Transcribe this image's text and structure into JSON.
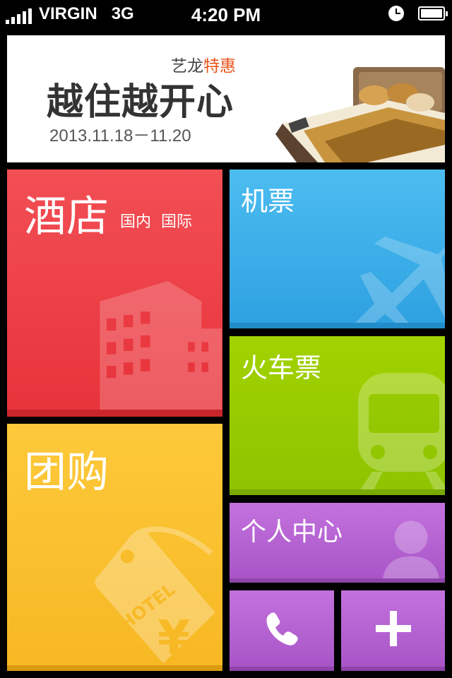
{
  "status_bar": {
    "carrier": "VIRGIN",
    "network": "3G",
    "time": "4:20 PM"
  },
  "banner": {
    "brand": "艺龙",
    "brand_highlight": "特惠",
    "headline": "越住越开心",
    "dates": "2013.11.18－11.20"
  },
  "tiles": {
    "hotel": {
      "label": "酒店",
      "sub_domestic": "国内",
      "sub_international": "国际"
    },
    "flight": {
      "label": "机票"
    },
    "train": {
      "label": "火车票"
    },
    "group_buy": {
      "label": "团购",
      "tag_text": "HOTEL"
    },
    "personal": {
      "label": "个人中心"
    },
    "phone": {
      "icon": "phone-icon"
    },
    "add": {
      "icon": "plus-icon"
    }
  },
  "colors": {
    "hotel": "#ef4048",
    "flight": "#3aaee8",
    "train": "#99cc00",
    "group_buy": "#fbc02d",
    "personal": "#b567d6",
    "banner_highlight": "#e9541b"
  }
}
